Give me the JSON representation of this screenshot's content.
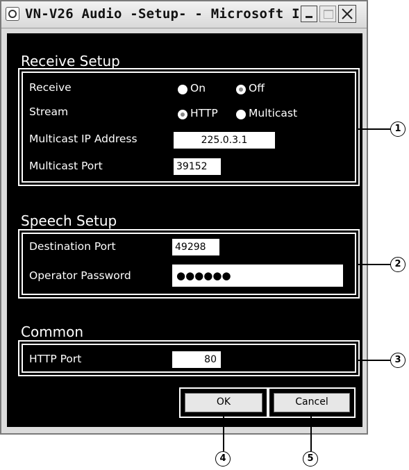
{
  "window": {
    "title": "VN-V26 Audio -Setup- - Microsoft I..",
    "minimize_icon": "minimize-icon",
    "maximize_icon": "maximize-icon",
    "close_icon": "close-icon"
  },
  "receive_setup": {
    "title": "Receive Setup",
    "receive_label": "Receive",
    "receive_on": "On",
    "receive_off": "Off",
    "receive_selected": "Off",
    "stream_label": "Stream",
    "stream_http": "HTTP",
    "stream_multicast": "Multicast",
    "stream_selected": "HTTP",
    "multicast_ip_label": "Multicast IP Address",
    "multicast_ip_value": "225.0.3.1",
    "multicast_port_label": "Multicast Port",
    "multicast_port_value": "39152"
  },
  "speech_setup": {
    "title": "Speech Setup",
    "destination_port_label": "Destination Port",
    "destination_port_value": "49298",
    "operator_password_label": "Operator Password",
    "operator_password_value": "●●●●●●"
  },
  "common": {
    "title": "Common",
    "http_port_label": "HTTP Port",
    "http_port_value": "80"
  },
  "buttons": {
    "ok": "OK",
    "cancel": "Cancel"
  },
  "callouts": [
    "1",
    "2",
    "3",
    "4",
    "5"
  ]
}
